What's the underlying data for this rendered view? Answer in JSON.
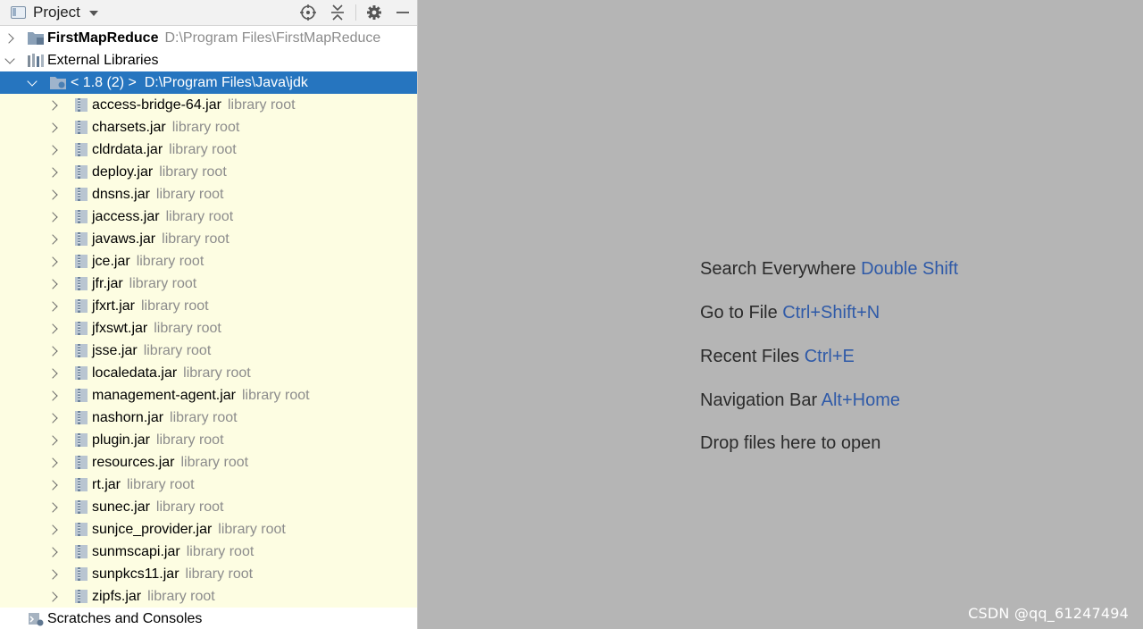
{
  "panel": {
    "title": "Project"
  },
  "tree": {
    "project": {
      "name": "FirstMapReduce",
      "path": "D:\\Program Files\\FirstMapReduce"
    },
    "external_libraries": "External Libraries",
    "jdk": {
      "label": "< 1.8 (2) >",
      "path": "D:\\Program Files\\Java\\jdk"
    },
    "jar_hint": "library root",
    "jars": [
      "access-bridge-64.jar",
      "charsets.jar",
      "cldrdata.jar",
      "deploy.jar",
      "dnsns.jar",
      "jaccess.jar",
      "javaws.jar",
      "jce.jar",
      "jfr.jar",
      "jfxrt.jar",
      "jfxswt.jar",
      "jsse.jar",
      "localedata.jar",
      "management-agent.jar",
      "nashorn.jar",
      "plugin.jar",
      "resources.jar",
      "rt.jar",
      "sunec.jar",
      "sunjce_provider.jar",
      "sunmscapi.jar",
      "sunpkcs11.jar",
      "zipfs.jar"
    ],
    "scratches": "Scratches and Consoles"
  },
  "editor_tips": [
    {
      "text": "Search Everywhere",
      "shortcut": "Double Shift"
    },
    {
      "text": "Go to File",
      "shortcut": "Ctrl+Shift+N"
    },
    {
      "text": "Recent Files",
      "shortcut": "Ctrl+E"
    },
    {
      "text": "Navigation Bar",
      "shortcut": "Alt+Home"
    },
    {
      "text": "Drop files here to open",
      "shortcut": ""
    }
  ],
  "watermark": "CSDN @qq_61247494",
  "colors": {
    "selection": "#2675bf",
    "library_row_bg": "#fdfde2",
    "shortcut": "#2f5aa8",
    "editor_bg": "#b5b5b5"
  }
}
